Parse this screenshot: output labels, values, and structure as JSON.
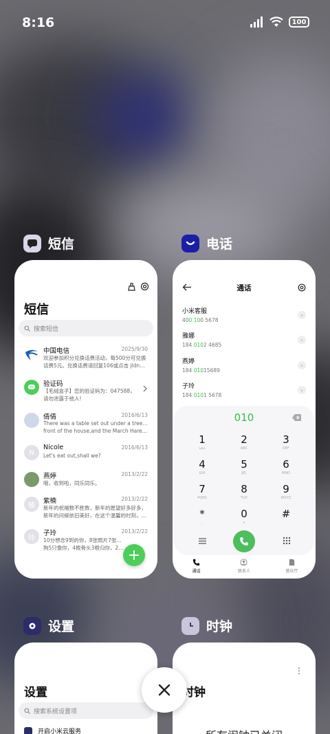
{
  "status": {
    "time": "8:16",
    "battery": "100"
  },
  "apps": {
    "sms": {
      "label": "短信",
      "title": "短信",
      "search_placeholder": "搜索短信",
      "messages": [
        {
          "name": "中国电信",
          "date": "2025/9/30",
          "preview1": "欢迎参加积分兑换话费活动，每500分可兑换",
          "preview2": "话费5元。兑换话费请回复106或点击 jldn#话费..."
        },
        {
          "name": "验证码",
          "date": "",
          "preview1": "【毛绒盒子】您的验证码为：047588，",
          "preview2": "请勿泄露于他人!"
        },
        {
          "name": "倩倩",
          "date": "2016/6/13",
          "preview1": "There was a table set out under a tree in",
          "preview2": "front of the house,and the March Hare an..."
        },
        {
          "name": "Nicole",
          "date": "2016/6/13",
          "preview1": "Let's eat out,shall we?",
          "preview2": ""
        },
        {
          "name": "燕婷",
          "date": "2013/2/22",
          "preview1": "哦，收到啦，同乐同乐。",
          "preview2": ""
        },
        {
          "name": "紫楠",
          "date": "2013/2/22",
          "preview1": "新年的祝福数不胜数，新年的愿望好多好多，",
          "preview2": "新年的问候依旧美好，在这个温馨的时刻，..."
        },
        {
          "name": "子玲",
          "date": "2013/2/22",
          "preview1": "10分想念9到的你，8张照片7张是你，6只小",
          "preview2": "狗5只像你，4根骨头3根归你，2爪朝你冲..."
        }
      ],
      "avatar_letters": {
        "nicole": "N",
        "zinan": "楠",
        "ziling": "玲"
      }
    },
    "phone": {
      "label": "电话",
      "title": "通话",
      "contacts": [
        {
          "name": "小米客服",
          "num_pre": "40",
          "num_hl": "0 10",
          "num_post": "0 5678"
        },
        {
          "name": "雅娜",
          "num_pre": "184 ",
          "num_hl": "010",
          "num_post": "2 4685"
        },
        {
          "name": "燕婷",
          "num_pre": "184 ",
          "num_hl": "010",
          "num_post": "15689"
        },
        {
          "name": "子玲",
          "num_pre": "184 ",
          "num_hl": "010",
          "num_post": "1 5678"
        }
      ],
      "dial_number": "010",
      "keys": [
        {
          "d": "1",
          "l": "ωω"
        },
        {
          "d": "2",
          "l": "ABC"
        },
        {
          "d": "3",
          "l": "DEF"
        },
        {
          "d": "4",
          "l": "GHI"
        },
        {
          "d": "5",
          "l": "JKL"
        },
        {
          "d": "6",
          "l": "MNO"
        },
        {
          "d": "7",
          "l": "PQRS"
        },
        {
          "d": "8",
          "l": "TUV"
        },
        {
          "d": "9",
          "l": "WXYZ"
        },
        {
          "d": "*",
          "l": ","
        },
        {
          "d": "0",
          "l": "+"
        },
        {
          "d": "#",
          "l": ""
        }
      ],
      "tabs": [
        "通话",
        "联系人",
        "营业厅"
      ]
    },
    "settings": {
      "label": "设置",
      "title": "设置",
      "search_placeholder": "搜索系统设置项",
      "first_item": "开启小米云服务"
    },
    "clock": {
      "label": "时钟",
      "title": "时钟",
      "empty_text": "所有闹钟已关闭"
    }
  },
  "colors": {
    "accent_green": "#4cce5a"
  }
}
